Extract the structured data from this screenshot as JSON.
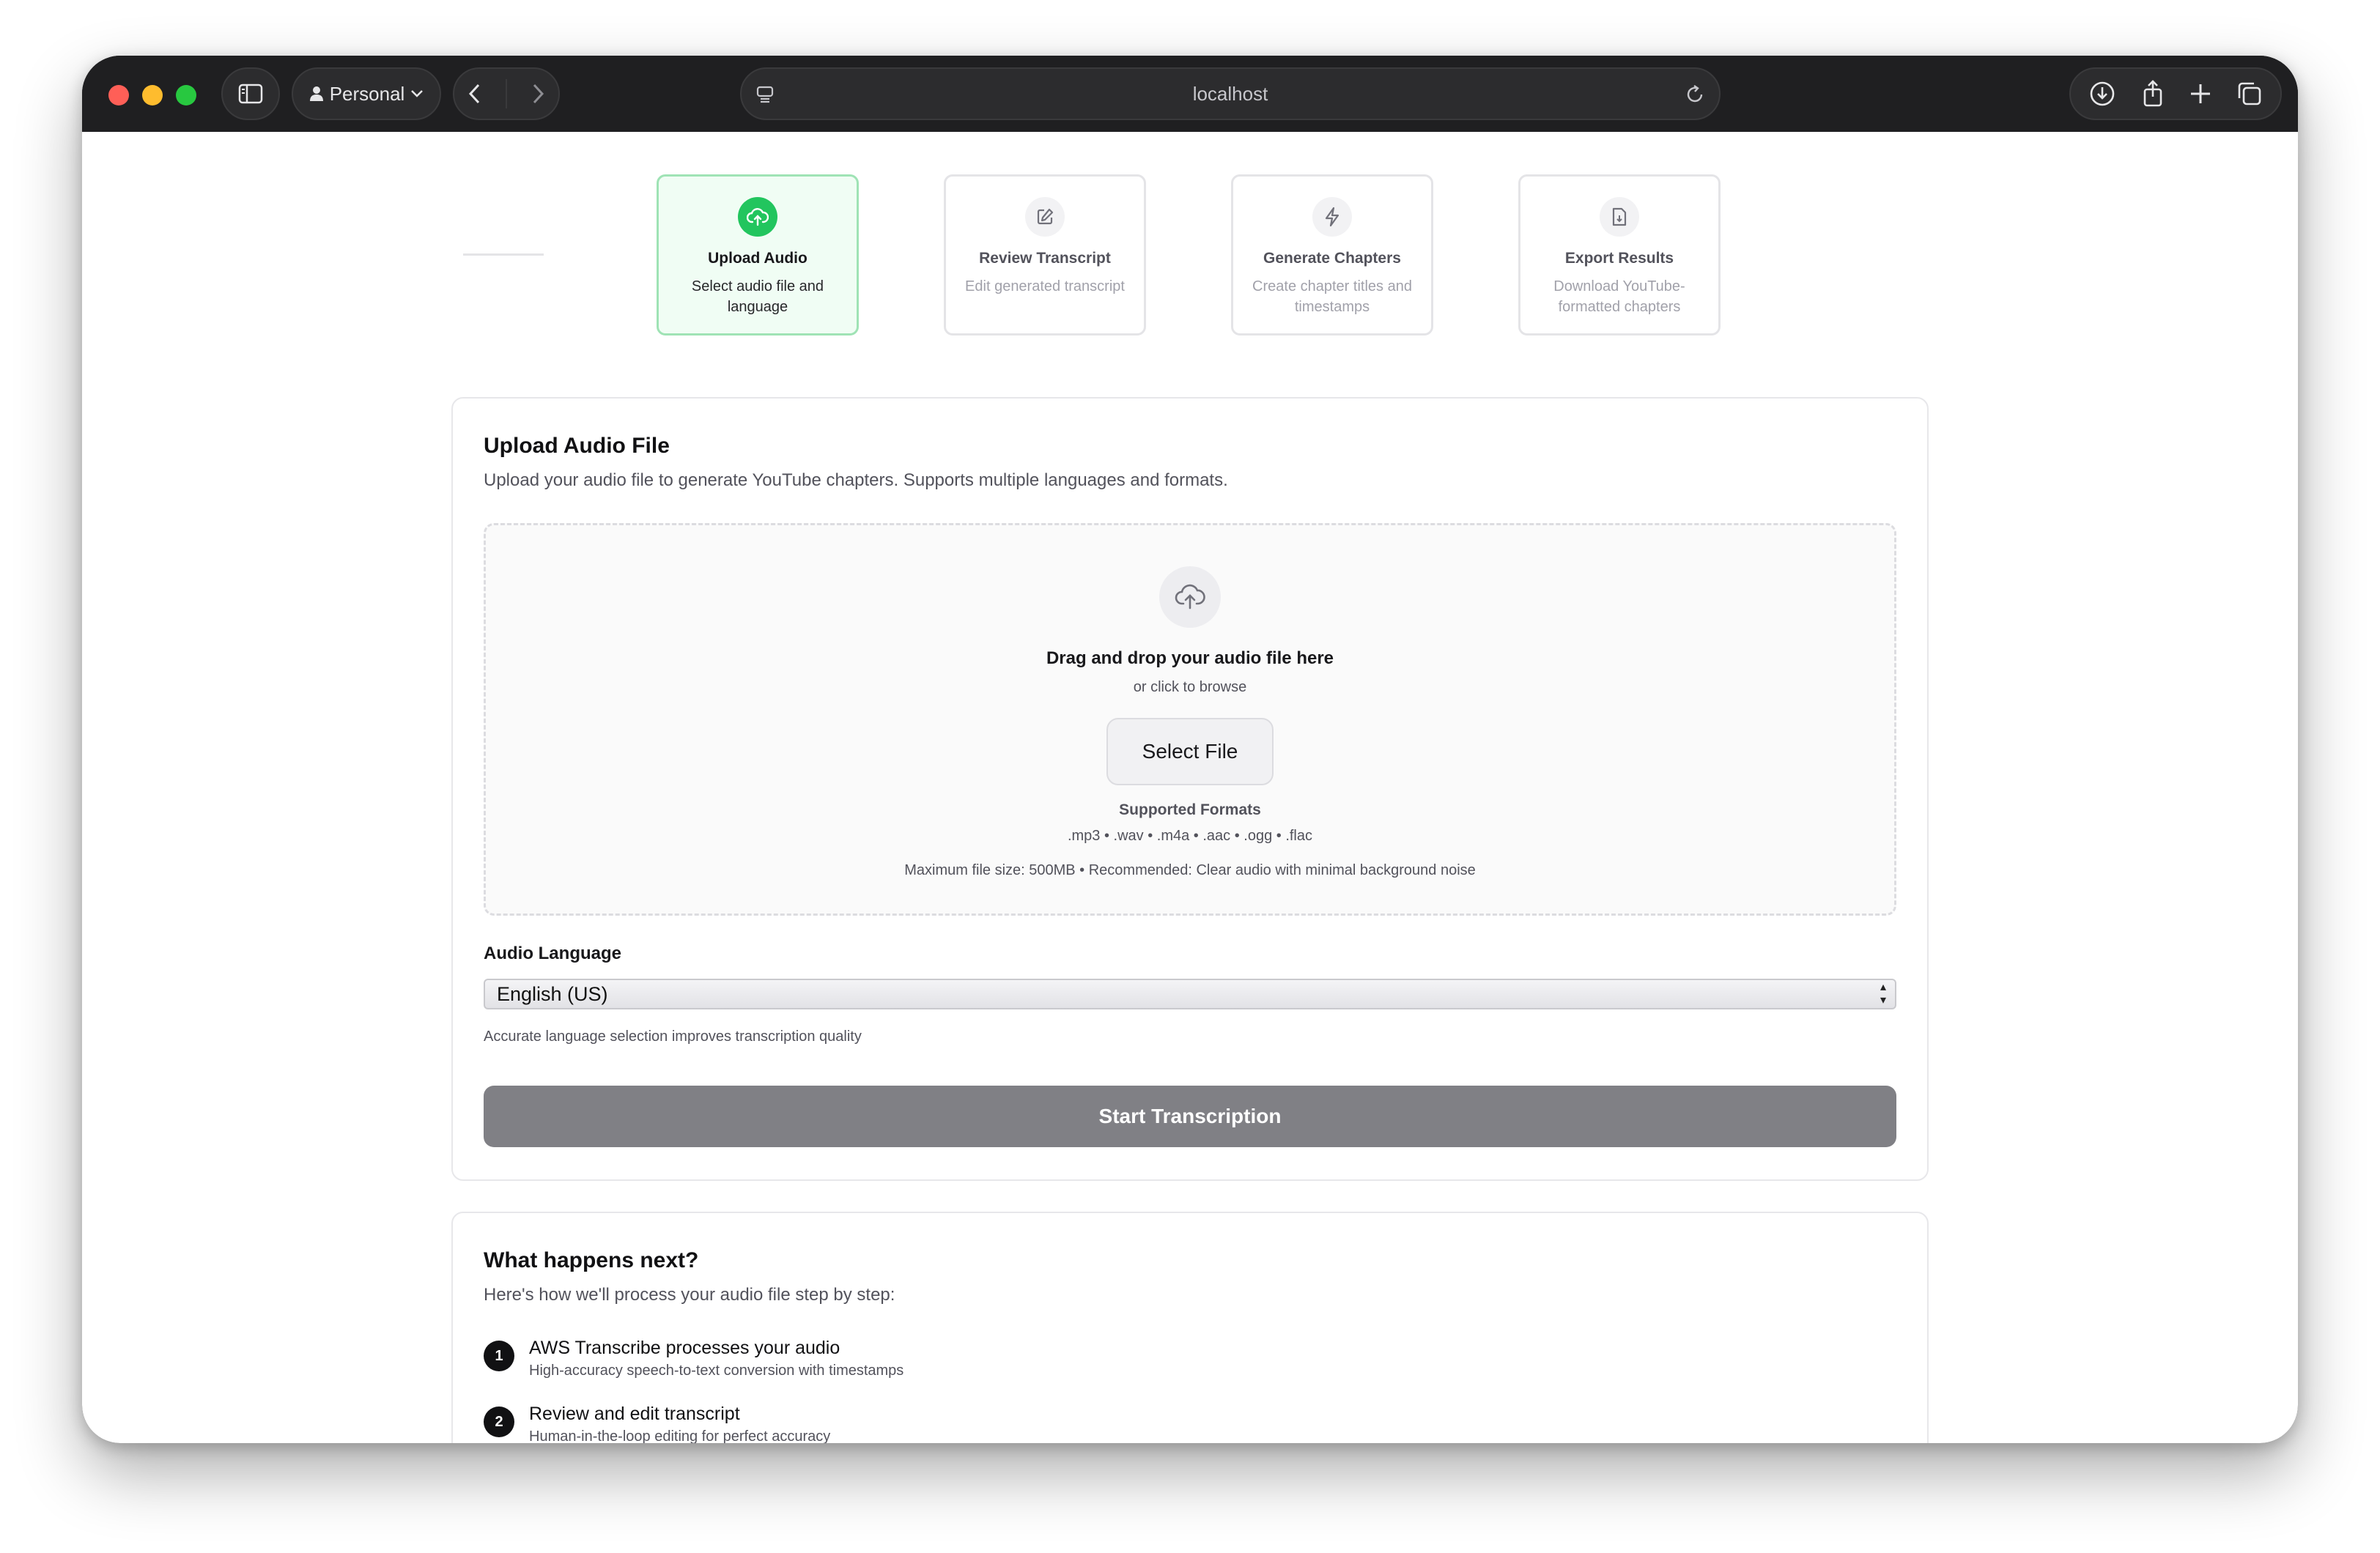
{
  "browser": {
    "profile_label": "Personal",
    "address": "localhost"
  },
  "stepper": [
    {
      "title": "Upload Audio",
      "subtitle": "Select audio file and language",
      "icon": "upload-cloud-icon",
      "active": true
    },
    {
      "title": "Review Transcript",
      "subtitle": "Edit generated transcript",
      "icon": "edit-icon",
      "active": false
    },
    {
      "title": "Generate Chapters",
      "subtitle": "Create chapter titles and timestamps",
      "icon": "lightning-icon",
      "active": false
    },
    {
      "title": "Export Results",
      "subtitle": "Download YouTube-formatted chapters",
      "icon": "file-icon",
      "active": false
    }
  ],
  "upload": {
    "title": "Upload Audio File",
    "description": "Upload your audio file to generate YouTube chapters. Supports multiple languages and formats.",
    "dropzone_title": "Drag and drop your audio file here",
    "dropzone_sub": "or click to browse",
    "select_file_label": "Select File",
    "formats_title": "Supported Formats",
    "formats": ".mp3 • .wav • .m4a • .aac • .ogg • .flac",
    "max_size": "Maximum file size: 500MB • Recommended: Clear audio with minimal background noise",
    "language_label": "Audio Language",
    "language_value": "English (US)",
    "language_hint": "Accurate language selection improves transcription quality",
    "start_label": "Start Transcription"
  },
  "next": {
    "title": "What happens next?",
    "description": "Here's how we'll process your audio file step by step:",
    "steps": [
      {
        "num": "1",
        "title": "AWS Transcribe processes your audio",
        "subtitle": "High-accuracy speech-to-text conversion with timestamps"
      },
      {
        "num": "2",
        "title": "Review and edit transcript",
        "subtitle": "Human-in-the-loop editing for perfect accuracy"
      }
    ]
  },
  "colors": {
    "accent": "#22c55e",
    "active_bg": "#f0fdf4",
    "start_button": "#808085"
  }
}
